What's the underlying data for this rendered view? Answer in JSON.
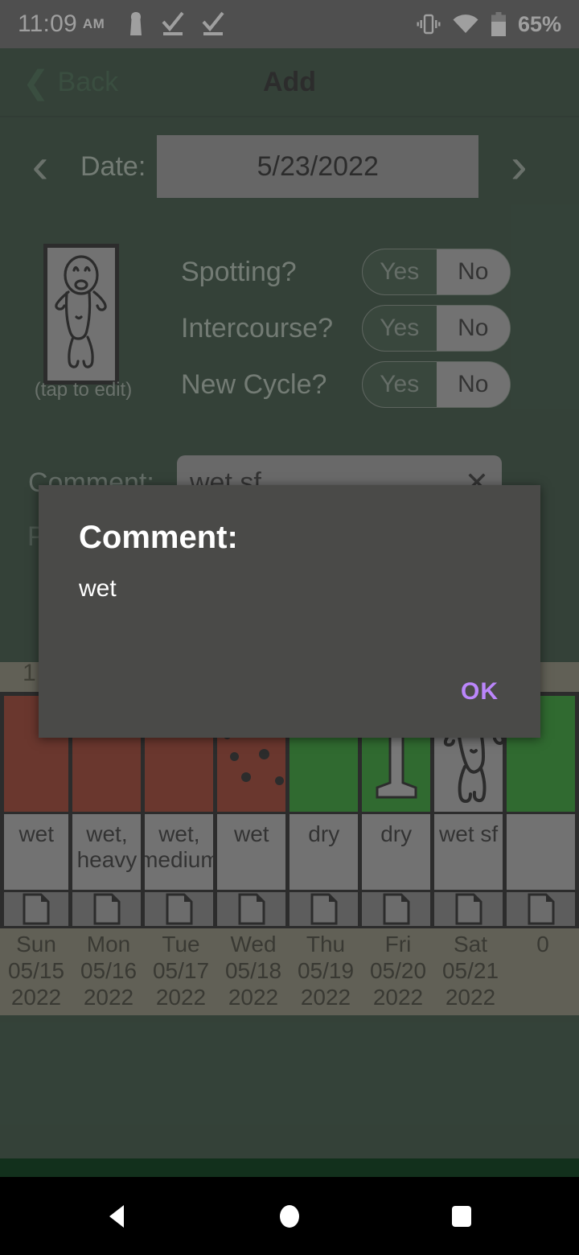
{
  "status_bar": {
    "time": "11:09",
    "ampm": "AM",
    "battery_percent": "65%",
    "icons": [
      "key-icon",
      "check-underline-icon",
      "check-underline-icon",
      "vibrate-icon",
      "wifi-icon",
      "battery-icon"
    ]
  },
  "app_bar": {
    "back_label": "Back",
    "title": "Add"
  },
  "date_row": {
    "prev_label": "‹",
    "next_label": "›",
    "label": "Date:",
    "value": "5/23/2022"
  },
  "form": {
    "thumb_caption": "(tap to edit)",
    "questions": [
      {
        "label": "Spotting?",
        "yes": "Yes",
        "no": "No",
        "selected": "No"
      },
      {
        "label": "Intercourse?",
        "yes": "Yes",
        "no": "No",
        "selected": "No"
      },
      {
        "label": "New Cycle?",
        "yes": "Yes",
        "no": "No",
        "selected": "No"
      }
    ],
    "comment_label": "Comment:",
    "comment_value": "wet sf",
    "comment_clear": "✕",
    "partial_label": "P"
  },
  "dialog": {
    "title": "Comment:",
    "body": "wet",
    "ok_label": "OK",
    "accent": "#bb86fc"
  },
  "chart": {
    "header_number": "1",
    "columns": [
      {
        "color": "red",
        "marker": "none",
        "comment": "wet",
        "note": "page-icon",
        "day": "Sun",
        "date": "05/15",
        "year": "2022"
      },
      {
        "color": "red",
        "marker": "none",
        "comment": "wet, heavy",
        "note": "page-icon",
        "day": "Mon",
        "date": "05/16",
        "year": "2022"
      },
      {
        "color": "red",
        "marker": "none",
        "comment": "wet, medium",
        "note": "page-icon",
        "day": "Tue",
        "date": "05/17",
        "year": "2022"
      },
      {
        "color": "red",
        "marker": "dots",
        "comment": "wet",
        "note": "page-icon",
        "day": "Wed",
        "date": "05/18",
        "year": "2022"
      },
      {
        "color": "green",
        "marker": "none",
        "comment": "dry",
        "note": "page-icon",
        "day": "Thu",
        "date": "05/19",
        "year": "2022"
      },
      {
        "color": "green",
        "marker": "pillar",
        "comment": "dry",
        "note": "page-icon",
        "day": "Fri",
        "date": "05/20",
        "year": "2022"
      },
      {
        "color": "gray",
        "marker": "baby",
        "comment": "wet sf",
        "note": "page-icon",
        "day": "Sat",
        "date": "05/21",
        "year": "2022"
      },
      {
        "color": "green",
        "marker": "none",
        "comment": "",
        "note": "page-icon",
        "day": "",
        "date": "0",
        "year": ""
      }
    ],
    "colors": {
      "red": "#8a1a06",
      "green": "#0a8a0a",
      "gray": "#9b9b9b",
      "date_band": "#77735d"
    }
  },
  "nav_bar": {
    "back": "back-triangle-icon",
    "home": "home-circle-icon",
    "recents": "recents-square-icon"
  },
  "theme": {
    "app_green": "#12301c",
    "accent_purple": "#bb86fc",
    "statusbar_gray": "#4e4e4e"
  }
}
